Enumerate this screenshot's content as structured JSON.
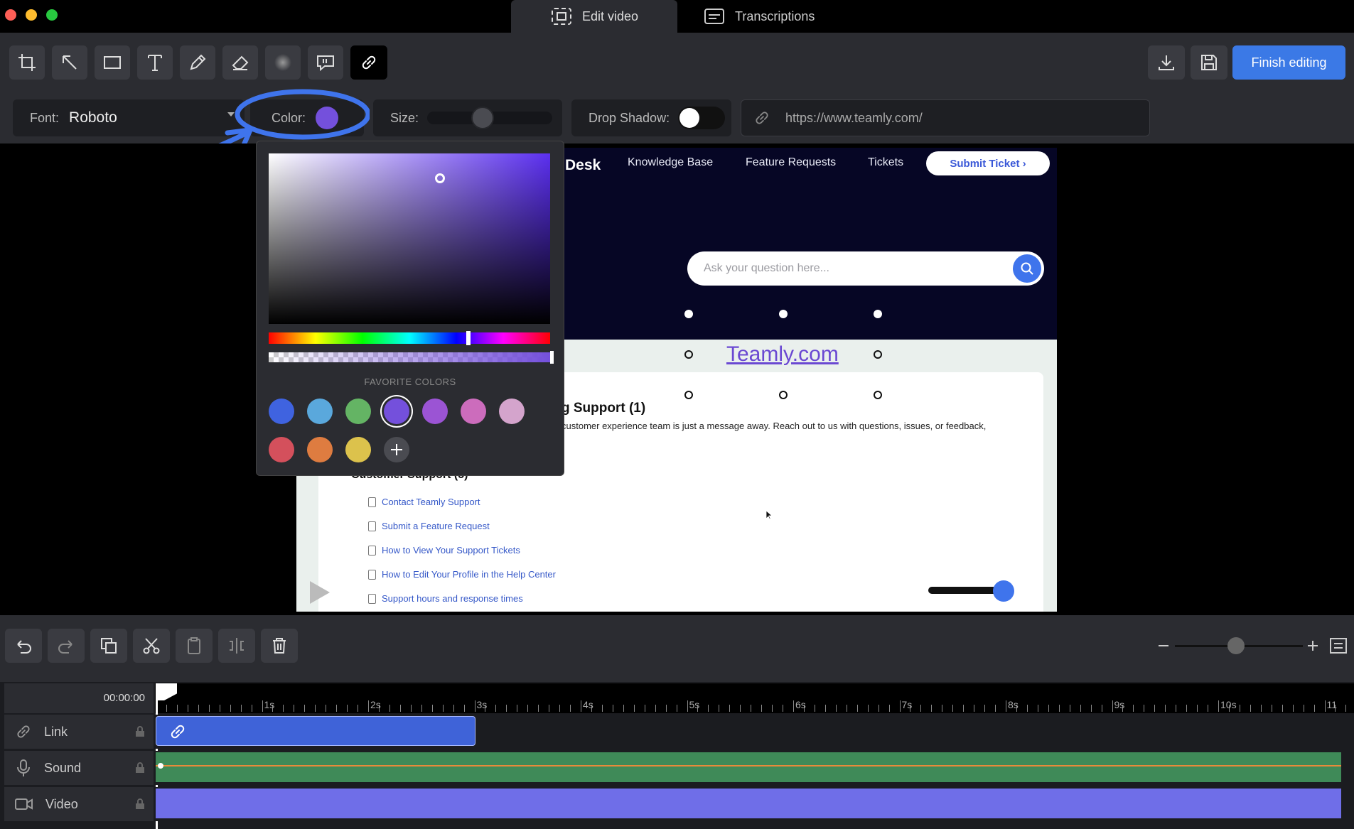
{
  "window": {
    "tabs": [
      {
        "label": "Edit video",
        "icon": "screen-select-icon"
      },
      {
        "label": "Transcriptions",
        "icon": "captions-icon"
      }
    ]
  },
  "toolbar": {
    "tools": [
      "crop-icon",
      "arrow-icon",
      "rectangle-icon",
      "text-icon",
      "pencil-icon",
      "eraser-icon",
      "blur-icon",
      "speech-bubble-icon",
      "link-icon"
    ],
    "finish_label": "Finish editing"
  },
  "options": {
    "font_label": "Font:",
    "font_value": "Roboto",
    "color_label": "Color:",
    "color_value": "#7450dc",
    "size_label": "Size:",
    "shadow_label": "Drop Shadow:",
    "url_value": "https://www.teamly.com/"
  },
  "color_picker": {
    "favorite_title": "FAVORITE COLORS",
    "favorites": [
      "#3f63e0",
      "#5aa8dc",
      "#64b464",
      "#7450dc",
      "#9b54d4",
      "#cc6cbc",
      "#d4a4cc",
      "#d4505c",
      "#de7c40",
      "#dcc24c"
    ],
    "selected_index": 3
  },
  "preview": {
    "brand_fragment": "Desk",
    "nav": [
      "Knowledge Base",
      "Feature Requests",
      "Tickets"
    ],
    "submit_label": "Submit Ticket ›",
    "search_placeholder": "Ask your question here...",
    "link_text": "Teamly.com",
    "section_title_fragment": "g Support (1)",
    "section_desc_fragment": "customer experience team is just a message away. Reach out to us with questions, issues, or feedback,",
    "subsection_fragment": "Customer Support (5)",
    "articles": [
      "Contact Teamly Support",
      "Submit a Feature Request",
      "How to View Your Support Tickets",
      "How to Edit Your Profile in the Help Center",
      "Support hours and response times"
    ]
  },
  "timeline": {
    "timecode": "00:00:00",
    "ticks": [
      "1s",
      "2s",
      "3s",
      "4s",
      "5s",
      "6s",
      "7s",
      "8s",
      "9s",
      "10s",
      "11"
    ],
    "tracks": [
      {
        "label": "Link",
        "icon": "link-icon"
      },
      {
        "label": "Sound",
        "icon": "microphone-icon"
      },
      {
        "label": "Video",
        "icon": "video-camera-icon"
      }
    ]
  }
}
